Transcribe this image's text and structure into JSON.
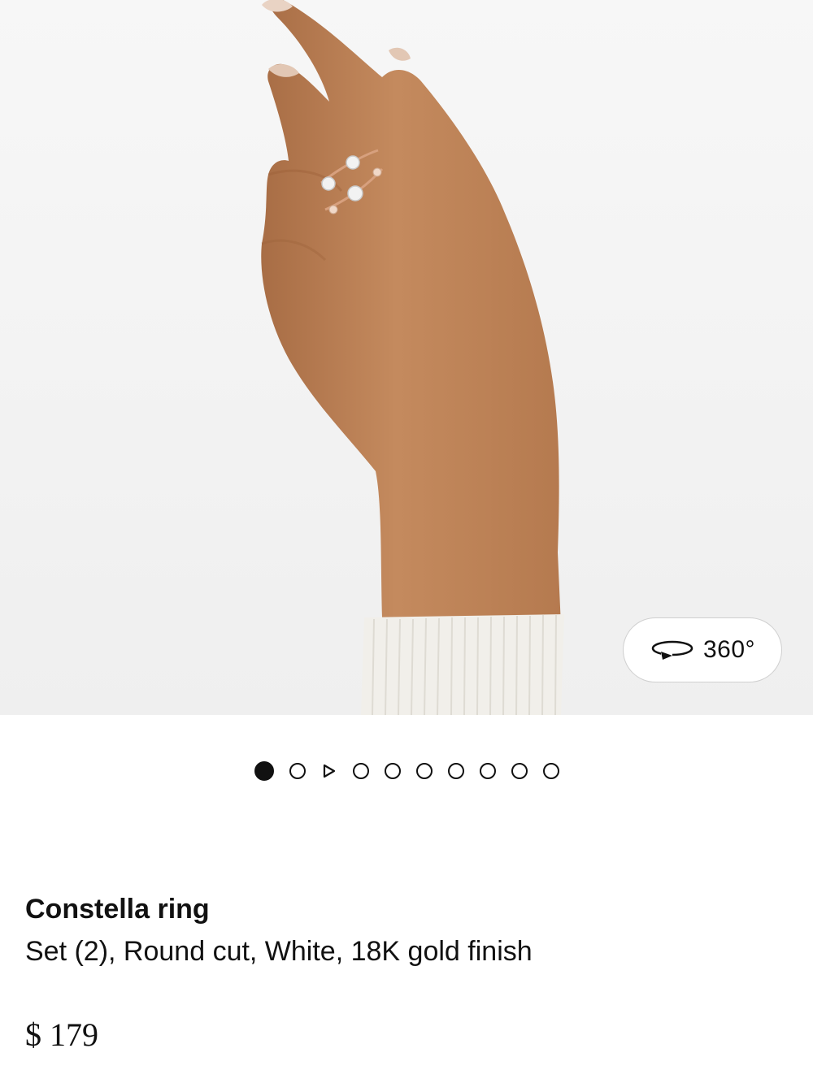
{
  "gallery": {
    "view_360_label": "360°",
    "view_360_icon": "rotate-360-icon",
    "dots": [
      {
        "type": "image",
        "active": true
      },
      {
        "type": "image",
        "active": false
      },
      {
        "type": "video",
        "active": false
      },
      {
        "type": "image",
        "active": false
      },
      {
        "type": "image",
        "active": false
      },
      {
        "type": "image",
        "active": false
      },
      {
        "type": "image",
        "active": false
      },
      {
        "type": "image",
        "active": false
      },
      {
        "type": "image",
        "active": false
      },
      {
        "type": "image",
        "active": false
      }
    ]
  },
  "product": {
    "name": "Constella ring",
    "description": "Set (2), Round cut, White, 18K gold finish",
    "price": "$ 179"
  },
  "colors": {
    "text": "#111111",
    "background": "#ffffff",
    "photo_background": "#f4f4f4",
    "skin": "#c48a5e",
    "sleeve": "#f1efea"
  }
}
